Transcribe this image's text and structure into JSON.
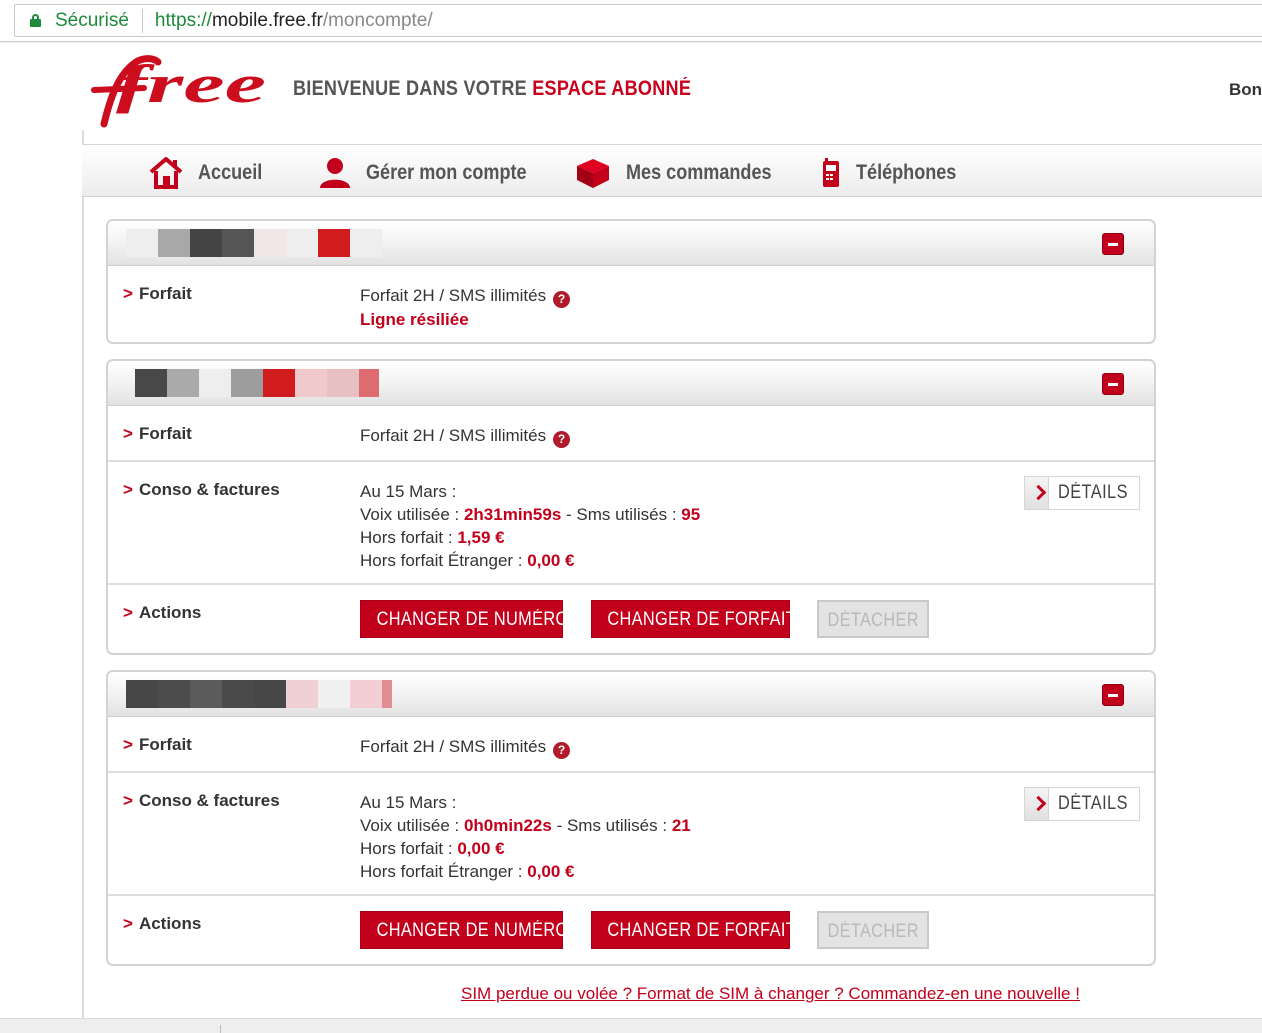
{
  "browser": {
    "secure_label": "Sécurisé",
    "url_scheme": "https://",
    "url_host": "mobile.free.fr",
    "url_path": "/moncompte/"
  },
  "header": {
    "logo_text": "free",
    "welcome_prefix": "BIENVENUE DANS VOTRE ",
    "welcome_highlight": "ESPACE ABONNÉ",
    "greeting_partial": "Bon"
  },
  "nav": {
    "items": [
      {
        "label": "Accueil",
        "icon": "home-icon"
      },
      {
        "label": "Gérer mon compte",
        "icon": "user-icon"
      },
      {
        "label": "Mes commandes",
        "icon": "box-icon"
      },
      {
        "label": "Téléphones",
        "icon": "phone-icon"
      }
    ]
  },
  "labels": {
    "forfait": "Forfait",
    "conso": "Conso & factures",
    "actions": "Actions",
    "gt": ">",
    "details": "DÉTAILS",
    "change_number": "CHANGER DE NUMÉRO",
    "change_plan": "CHANGER DE FORFAIT",
    "detach": "DÉTACHER",
    "date_line": "Au 15 Mars :",
    "voice_prefix": "Voix utilisée : ",
    "sms_prefix": " - Sms utilisés : ",
    "hors_forfait": "Hors forfait : ",
    "hors_forfait_etranger": "Hors forfait Étranger : ",
    "help": "?"
  },
  "lines": [
    {
      "plan": "Forfait 2H / SMS illimités",
      "status": "Ligne résiliée",
      "redacted_colors": [
        "#eeeeee",
        "#a8a8a8",
        "#444444",
        "#555555",
        "#f1e7e7",
        "#eeeeee",
        "#d01c1f",
        "#eeeeee"
      ]
    },
    {
      "plan": "Forfait 2H / SMS illimités",
      "voice": "2h31min59s",
      "sms": "95",
      "hors_forfait": "1,59 €",
      "hors_forfait_etranger": "0,00 €",
      "redacted_colors": [
        "#484848",
        "#aaaaaa",
        "#eeeeee",
        "#9d9d9d",
        "#d01c1f",
        "#f0c9cc",
        "#e8c0c3",
        "#dd6b6f"
      ]
    },
    {
      "plan": "Forfait 2H / SMS illimités",
      "voice": "0h0min22s",
      "sms": "21",
      "hors_forfait": "0,00 €",
      "hors_forfait_etranger": "0,00 €",
      "redacted_colors": [
        "#474747",
        "#4c4c4c",
        "#5b5b5b",
        "#4a4a4a",
        "#474747",
        "#f0d0d4",
        "#f0f0f0",
        "#f2cfd3",
        "#e18d92"
      ]
    }
  ],
  "sim_link": "SIM perdue ou volée ? Format de SIM à changer ? Commandez-en une nouvelle !"
}
